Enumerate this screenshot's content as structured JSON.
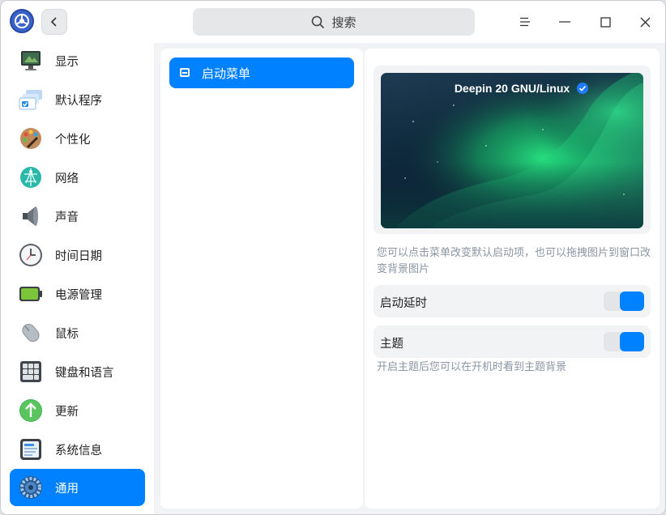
{
  "header": {
    "search_placeholder": "搜索"
  },
  "sidebar": {
    "items": [
      {
        "label": "显示",
        "icon": "monitor-icon"
      },
      {
        "label": "默认程序",
        "icon": "default-apps-icon"
      },
      {
        "label": "个性化",
        "icon": "palette-icon"
      },
      {
        "label": "网络",
        "icon": "network-icon"
      },
      {
        "label": "声音",
        "icon": "speaker-icon"
      },
      {
        "label": "时间日期",
        "icon": "clock-icon"
      },
      {
        "label": "电源管理",
        "icon": "battery-icon"
      },
      {
        "label": "鼠标",
        "icon": "mouse-icon"
      },
      {
        "label": "键盘和语言",
        "icon": "keyboard-icon"
      },
      {
        "label": "更新",
        "icon": "update-icon"
      },
      {
        "label": "系统信息",
        "icon": "system-info-icon"
      },
      {
        "label": "通用",
        "icon": "general-gear-icon"
      }
    ],
    "active_index": 11
  },
  "middle": {
    "items": [
      {
        "label": "启动菜单",
        "icon": "boot-menu-icon"
      }
    ]
  },
  "boot": {
    "entry": "Deepin 20 GNU/Linux",
    "hint": "您可以点击菜单改变默认启动项，也可以拖拽图片到窗口改变背景图片",
    "delay_label": "启动延时",
    "delay_on": true,
    "theme_label": "主题",
    "theme_on": true,
    "theme_hint": "开启主题后您可以在开机时看到主题背景"
  },
  "colors": {
    "accent": "#0081ff",
    "window_bg": "#f2f3f5",
    "hint_text": "#8a95a3"
  }
}
